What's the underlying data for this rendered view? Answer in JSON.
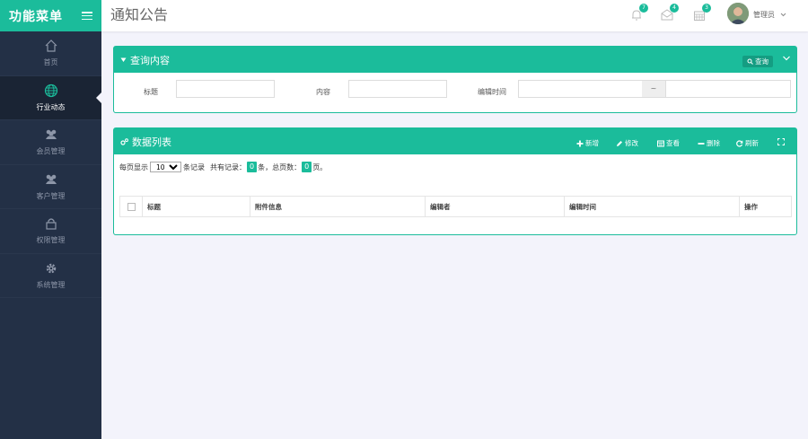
{
  "sidebar": {
    "title": "功能菜单",
    "items": [
      {
        "label": "首页",
        "icon": "home-icon"
      },
      {
        "label": "行业动态",
        "icon": "globe-icon"
      },
      {
        "label": "会员管理",
        "icon": "users-icon"
      },
      {
        "label": "客户管理",
        "icon": "users-icon"
      },
      {
        "label": "权限管理",
        "icon": "lock-icon"
      },
      {
        "label": "系统管理",
        "icon": "gear-icon"
      }
    ]
  },
  "header": {
    "title": "通知公告",
    "bell_badge": "7",
    "mail_badge": "4",
    "calendar_badge": "3",
    "user_name": "管理员"
  },
  "query_panel": {
    "title": "查询内容",
    "query_button": "查询",
    "fields": {
      "title_label": "标题",
      "content_label": "内容",
      "edit_time_label": "编辑时间",
      "range_separator": "~"
    }
  },
  "data_panel": {
    "title": "数据列表",
    "toolbar": {
      "add": "新增",
      "edit": "修改",
      "view": "查看",
      "delete": "删除",
      "refresh": "刷新"
    },
    "pagination": {
      "per_page_prefix": "每页显示",
      "per_page_value": "10",
      "per_page_suffix": "条记录",
      "total_prefix": "共有记录：",
      "total_records": "0",
      "total_suffix": "条，总页数：",
      "total_pages": "0",
      "pages_suffix": "页。"
    },
    "columns": [
      "标题",
      "附件信息",
      "编辑者",
      "编辑时间",
      "操作"
    ]
  },
  "colors": {
    "accent": "#1bbc9b",
    "sidebar_bg": "#233046"
  }
}
